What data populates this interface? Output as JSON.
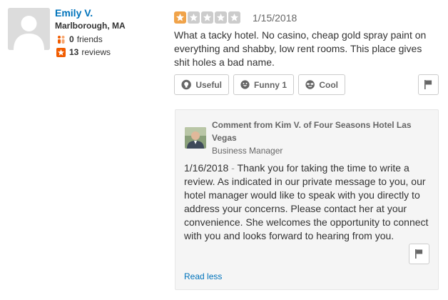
{
  "user": {
    "name": "Emily V.",
    "location": "Marlborough, MA",
    "friends_count": "0",
    "friends_label": "friends",
    "reviews_count": "13",
    "reviews_label": "reviews"
  },
  "review": {
    "rating": 1,
    "rating_max": 5,
    "date": "1/15/2018",
    "text": "What a tacky hotel. No casino, cheap gold spray paint on everything and shabby,  low rent rooms. This place gives shit holes a bad name."
  },
  "votes": {
    "useful_label": "Useful",
    "funny_label": "Funny",
    "funny_count": "1",
    "cool_label": "Cool"
  },
  "owner_comment": {
    "heading": "Comment from Kim V. of Four Seasons Hotel Las Vegas",
    "role": "Business Manager",
    "date": "1/16/2018",
    "separator": " - ",
    "text": "Thank you for taking the time to write a review. As indicated in our private message to you, our hotel manager would like to speak with you directly to address your concerns. Please contact her at your convenience. She welcomes the opportunity to connect with you and looks forward to hearing from you.",
    "read_less_label": "Read less"
  },
  "colors": {
    "star_filled": "#f0a34a",
    "star_empty": "#cccccc",
    "link": "#0073bb",
    "friends_icon": "#f15c00",
    "reviews_icon": "#f15c00"
  },
  "icons": {
    "friends": "friends-icon",
    "reviews": "star-badge-icon",
    "useful": "lightbulb-icon",
    "funny": "smiley-icon",
    "cool": "sunglasses-icon",
    "flag": "flag-icon"
  }
}
